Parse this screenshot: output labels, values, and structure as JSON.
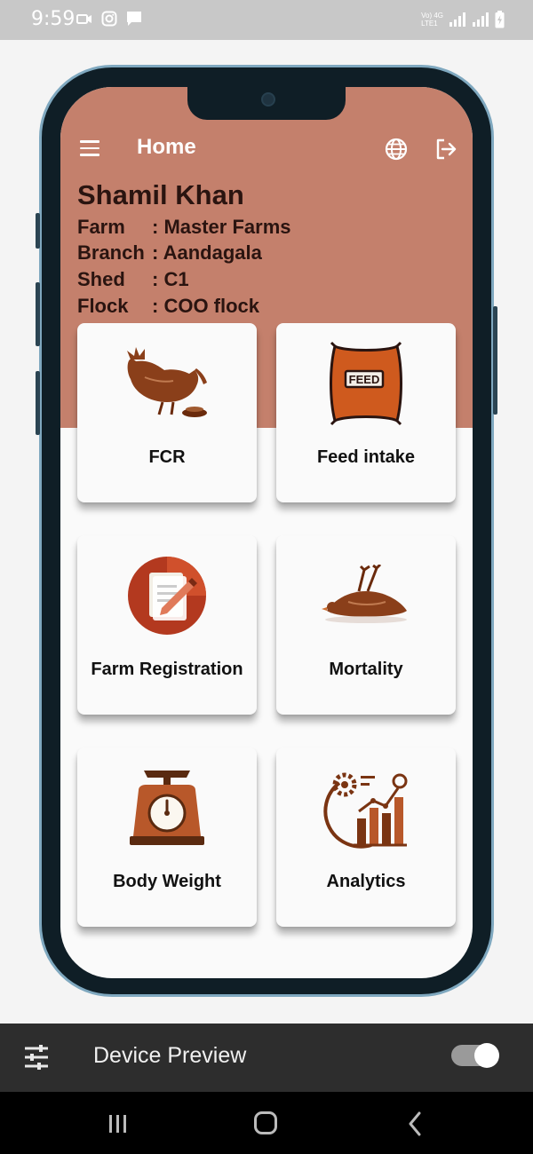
{
  "status_bar": {
    "time": "9:59",
    "network_label_top": "Vo) 4G",
    "network_label_bottom": "LTE1"
  },
  "app_bar": {
    "title": "Home"
  },
  "user": {
    "name": "Shamil Khan",
    "rows": [
      {
        "label": "Farm",
        "value": ": Master Farms"
      },
      {
        "label": "Branch",
        "value": ": Aandagala"
      },
      {
        "label": "Shed",
        "value": ": C1"
      },
      {
        "label": "Flock",
        "value": ": COO flock"
      }
    ]
  },
  "tiles": [
    {
      "label": "FCR",
      "icon": "hen-eating-icon"
    },
    {
      "label": "Feed intake",
      "icon": "feed-bag-icon"
    },
    {
      "label": "Farm Registration",
      "icon": "registration-doc-icon"
    },
    {
      "label": "Mortality",
      "icon": "dead-bird-icon"
    },
    {
      "label": "Body Weight",
      "icon": "weighing-scale-icon"
    },
    {
      "label": "Analytics",
      "icon": "analytics-chart-icon"
    }
  ],
  "feed_bag_text": "FEED",
  "device_preview": {
    "label": "Device Preview",
    "toggle_on": true
  },
  "colors": {
    "header": "#c4806c",
    "brown_icon": "#8a3f1a",
    "text_dark": "#2a1410"
  }
}
